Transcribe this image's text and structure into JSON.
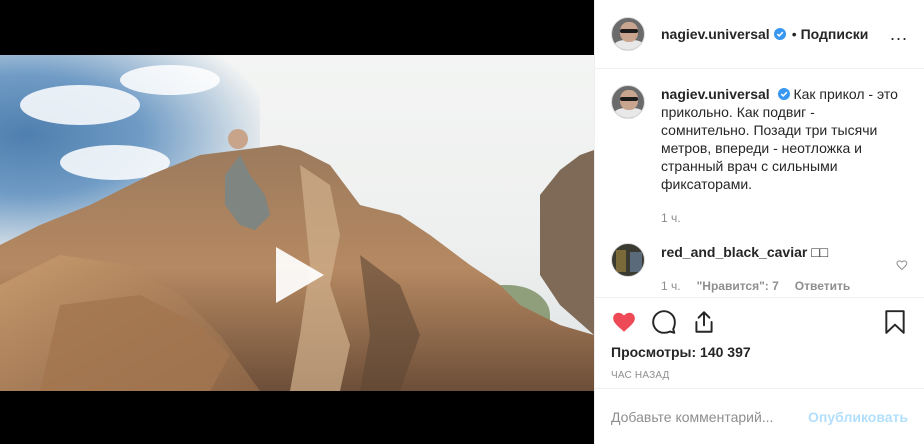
{
  "post": {
    "username": "nagiev.universal",
    "follow_label": "Подписки",
    "dot": "•",
    "more": "...",
    "caption": "Как прикол - это прикольно. Как подвиг - сомнительно. Позади три тысячи метров, впереди - неотложка и странный врач с сильными фиксаторами.",
    "caption_time": "1 ч."
  },
  "comments": [
    {
      "username": "red_and_black_caviar",
      "text": "□□",
      "time": "1 ч.",
      "likes": "\"Нравится\": 7",
      "reply_label": "Ответить"
    }
  ],
  "stats": {
    "views": "Просмотры: 140 397",
    "posted": "час назад"
  },
  "composer": {
    "placeholder": "Добавьте комментарий...",
    "post_label": "Опубликовать"
  },
  "colors": {
    "like_red": "#ed4956",
    "verified_blue": "#3897f0",
    "post_disabled": "#b2dffc"
  },
  "icons": [
    "play-icon",
    "verified-icon",
    "heart-icon",
    "comment-icon",
    "share-icon",
    "bookmark-icon"
  ]
}
